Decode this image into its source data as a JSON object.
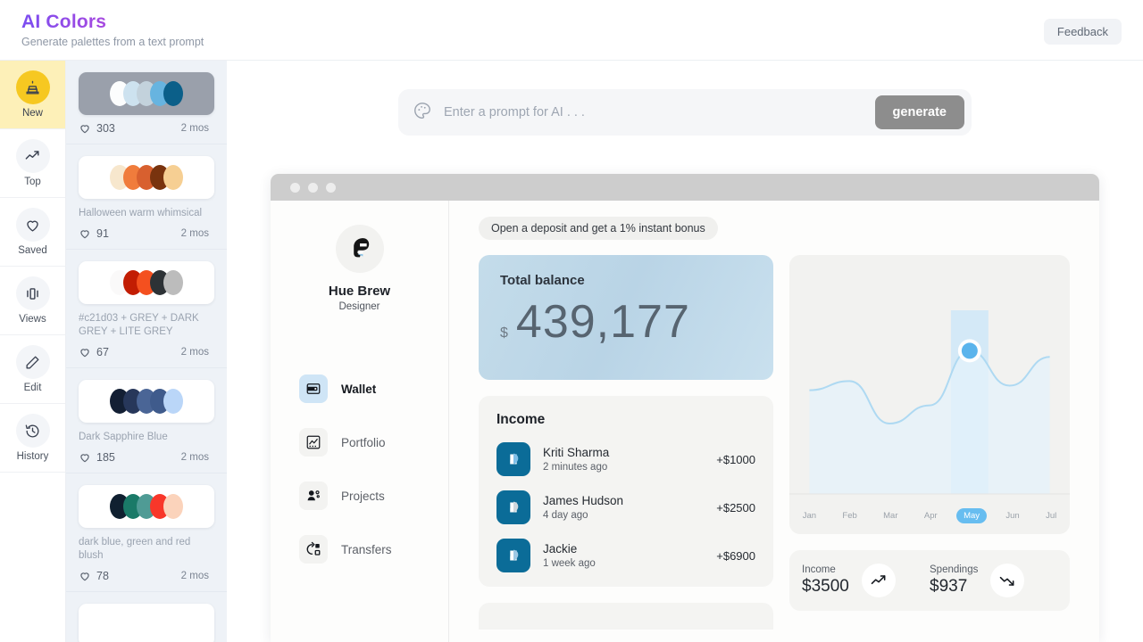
{
  "header": {
    "title": "AI Colors",
    "subtitle": "Generate palettes from a text prompt",
    "feedback_label": "Feedback"
  },
  "sidebar": {
    "items": [
      {
        "label": "New",
        "icon": "cake-icon",
        "active": true
      },
      {
        "label": "Top",
        "icon": "trending-up-icon",
        "active": false
      },
      {
        "label": "Saved",
        "icon": "heart-icon",
        "active": false
      },
      {
        "label": "Views",
        "icon": "carousel-icon",
        "active": false
      },
      {
        "label": "Edit",
        "icon": "pencil-icon",
        "active": false
      },
      {
        "label": "History",
        "icon": "clock-rewind-icon",
        "active": false
      }
    ]
  },
  "palettes": [
    {
      "name": "",
      "likes": "303",
      "age": "2 mos",
      "card_bg": "#9aa0ab",
      "colors": [
        "#fcfdfd",
        "#cde2ef",
        "#c3d2dc",
        "#67b4e0",
        "#0b5f89"
      ]
    },
    {
      "name": "Halloween warm whimsical",
      "likes": "91",
      "age": "2 mos",
      "card_bg": "#ffffff",
      "colors": [
        "#f7e7cd",
        "#f07c3c",
        "#d8602f",
        "#79330e",
        "#f6cf93"
      ]
    },
    {
      "name": "#c21d03 + GREY + DARK GREY + LITE GREY",
      "likes": "67",
      "age": "2 mos",
      "card_bg": "#ffffff",
      "colors": [
        "#faf9f9",
        "#c21d03",
        "#f4501f",
        "#2d3236",
        "#bcbcbc"
      ]
    },
    {
      "name": "Dark Sapphire Blue",
      "likes": "185",
      "age": "2 mos",
      "card_bg": "#ffffff",
      "colors": [
        "#131f34",
        "#27375a",
        "#4a6596",
        "#3f5b8c",
        "#bad6f8"
      ]
    },
    {
      "name": "dark blue, green and red blush",
      "likes": "78",
      "age": "2 mos",
      "card_bg": "#ffffff",
      "colors": [
        "#102030",
        "#1a7a68",
        "#4f9b95",
        "#f8372a",
        "#fbd3bb"
      ]
    }
  ],
  "prompt": {
    "placeholder": "Enter a prompt for AI . . .",
    "value": "",
    "generate_label": "generate",
    "icon": "palette-icon"
  },
  "preview": {
    "profile": {
      "name": "Hue Brew",
      "role": "Designer"
    },
    "nav": [
      {
        "label": "Wallet",
        "icon": "wallet-icon",
        "active": true
      },
      {
        "label": "Portfolio",
        "icon": "chart-square-icon",
        "active": false
      },
      {
        "label": "Projects",
        "icon": "users-gear-icon",
        "active": false
      },
      {
        "label": "Transfers",
        "icon": "transfer-icon",
        "active": false
      }
    ],
    "banner": "Open a deposit and get a 1% instant bonus",
    "balance": {
      "title": "Total balance",
      "currency": "$",
      "value": "439,177"
    },
    "income": {
      "title": "Income",
      "rows": [
        {
          "name": "Kriti Sharma",
          "time": "2 minutes ago",
          "amount": "+$1000"
        },
        {
          "name": "James Hudson",
          "time": "4 day ago",
          "amount": "+$2500"
        },
        {
          "name": "Jackie",
          "time": "1 week ago",
          "amount": "+$6900"
        }
      ]
    },
    "stats": [
      {
        "label": "Income",
        "value": "$3500",
        "icon": "trend-up-icon"
      },
      {
        "label": "Spendings",
        "value": "$937",
        "icon": "trend-down-icon"
      }
    ]
  },
  "chart_data": {
    "type": "area",
    "title": "",
    "categories": [
      "Jan",
      "Feb",
      "Mar",
      "Apr",
      "May",
      "Jun",
      "Jul"
    ],
    "values": [
      52,
      58,
      30,
      42,
      78,
      55,
      74
    ],
    "highlight_category": "May",
    "highlight_value": 78,
    "xlabel": "",
    "ylabel": "",
    "ylim": [
      0,
      100
    ],
    "grid": false,
    "legend": "none",
    "line_color": "#aed9f2",
    "fill_color": "#e4f2fb",
    "marker_color": "#5bb4ec"
  }
}
